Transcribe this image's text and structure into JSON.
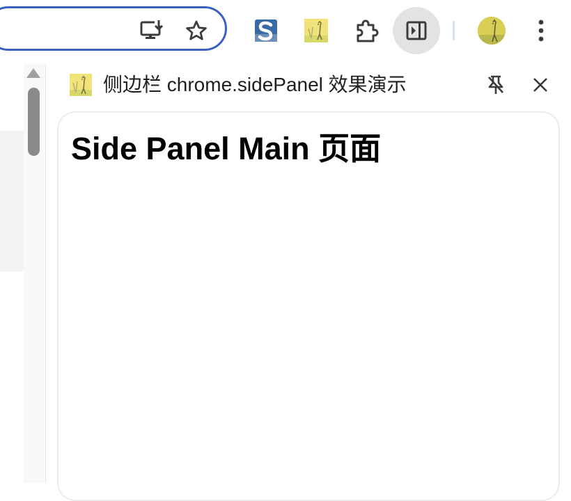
{
  "toolbar": {
    "icons": {
      "install": "install-app-icon",
      "bookmark": "star-icon",
      "extension_s": "s-extension-icon",
      "extension_giraffe": "giraffe-extension-icon",
      "extensions": "puzzle-icon",
      "side_panel": "side-panel-icon",
      "profile": "avatar",
      "menu": "more-vert-icon"
    },
    "colors": {
      "omnibox_border": "#3b5fc4",
      "side_panel_active_bg": "#e3e3e3"
    }
  },
  "side_panel": {
    "title": "侧边栏 chrome.sidePanel 效果演示",
    "icons": {
      "favicon": "giraffe-favicon",
      "unpin": "unpin-icon",
      "close": "close-icon"
    },
    "content": {
      "heading": "Side Panel Main 页面"
    }
  }
}
